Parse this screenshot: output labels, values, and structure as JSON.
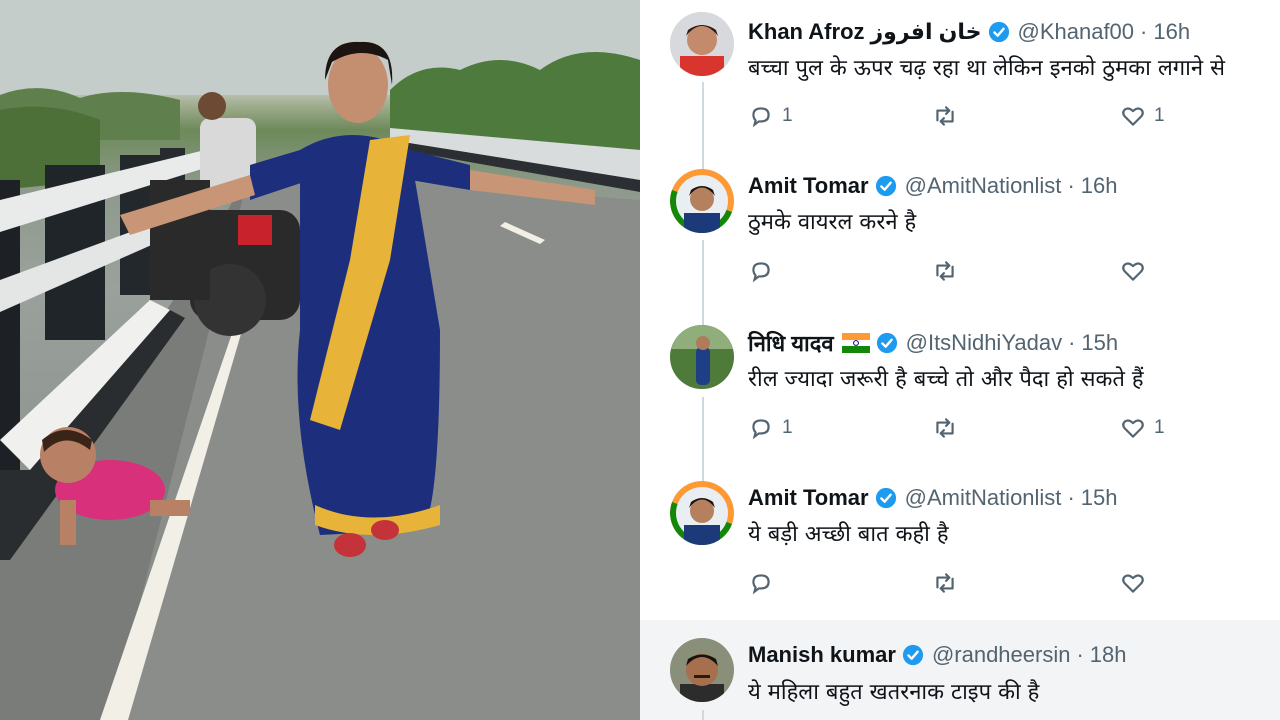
{
  "photo": {
    "description_icon": "woman-dancing-on-bridge-with-crawling-baby-photo"
  },
  "tweets": [
    {
      "display_name": "Khan Afroz",
      "extra_name": "خان افروز",
      "handle": "@Khanaf00",
      "time": "16h",
      "text": "बच्चा पुल के ऊपर चढ़ रहा था लेकिन इनको ठुमका लगाने से",
      "reply_count": "1",
      "retweet_count": "",
      "like_count": "1",
      "avatar_icon": "profile-photo-man-red-shirt"
    },
    {
      "display_name": "Amit Tomar",
      "handle": "@AmitNationlist",
      "time": "16h",
      "text": "ठुमके वायरल करने है",
      "reply_count": "",
      "retweet_count": "",
      "like_count": "",
      "avatar_icon": "profile-photo-man-flag-ring"
    },
    {
      "display_name": "निधि यादव",
      "handle": "@ItsNidhiYadav",
      "time": "15h",
      "text": "रील ज्यादा जरूरी है बच्चे तो और पैदा हो सकते हैं",
      "reply_count": "1",
      "retweet_count": "",
      "like_count": "1",
      "avatar_icon": "profile-photo-woman-outdoors"
    },
    {
      "display_name": "Amit Tomar",
      "handle": "@AmitNationlist",
      "time": "15h",
      "text": "ये बड़ी अच्छी बात कही है",
      "reply_count": "",
      "retweet_count": "",
      "like_count": "",
      "avatar_icon": "profile-photo-man-flag-ring"
    },
    {
      "display_name": "Manish kumar",
      "handle": "@randheersin",
      "time": "18h",
      "text": "ये महिला बहुत खतरनाक टाइप की है",
      "reply_count": "",
      "retweet_count": "",
      "like_count": "",
      "avatar_icon": "profile-photo-man-mustache"
    }
  ],
  "separator": "·",
  "colors": {
    "verified_blue": "#1d9bf0",
    "text_primary": "#0f1419",
    "text_secondary": "#536471",
    "highlight_bg": "#f3f4f5"
  },
  "icons": {
    "reply": "reply-icon",
    "retweet": "retweet-icon",
    "like": "like-heart-icon",
    "verified": "verified-badge-icon",
    "flag": "india-flag-icon"
  }
}
